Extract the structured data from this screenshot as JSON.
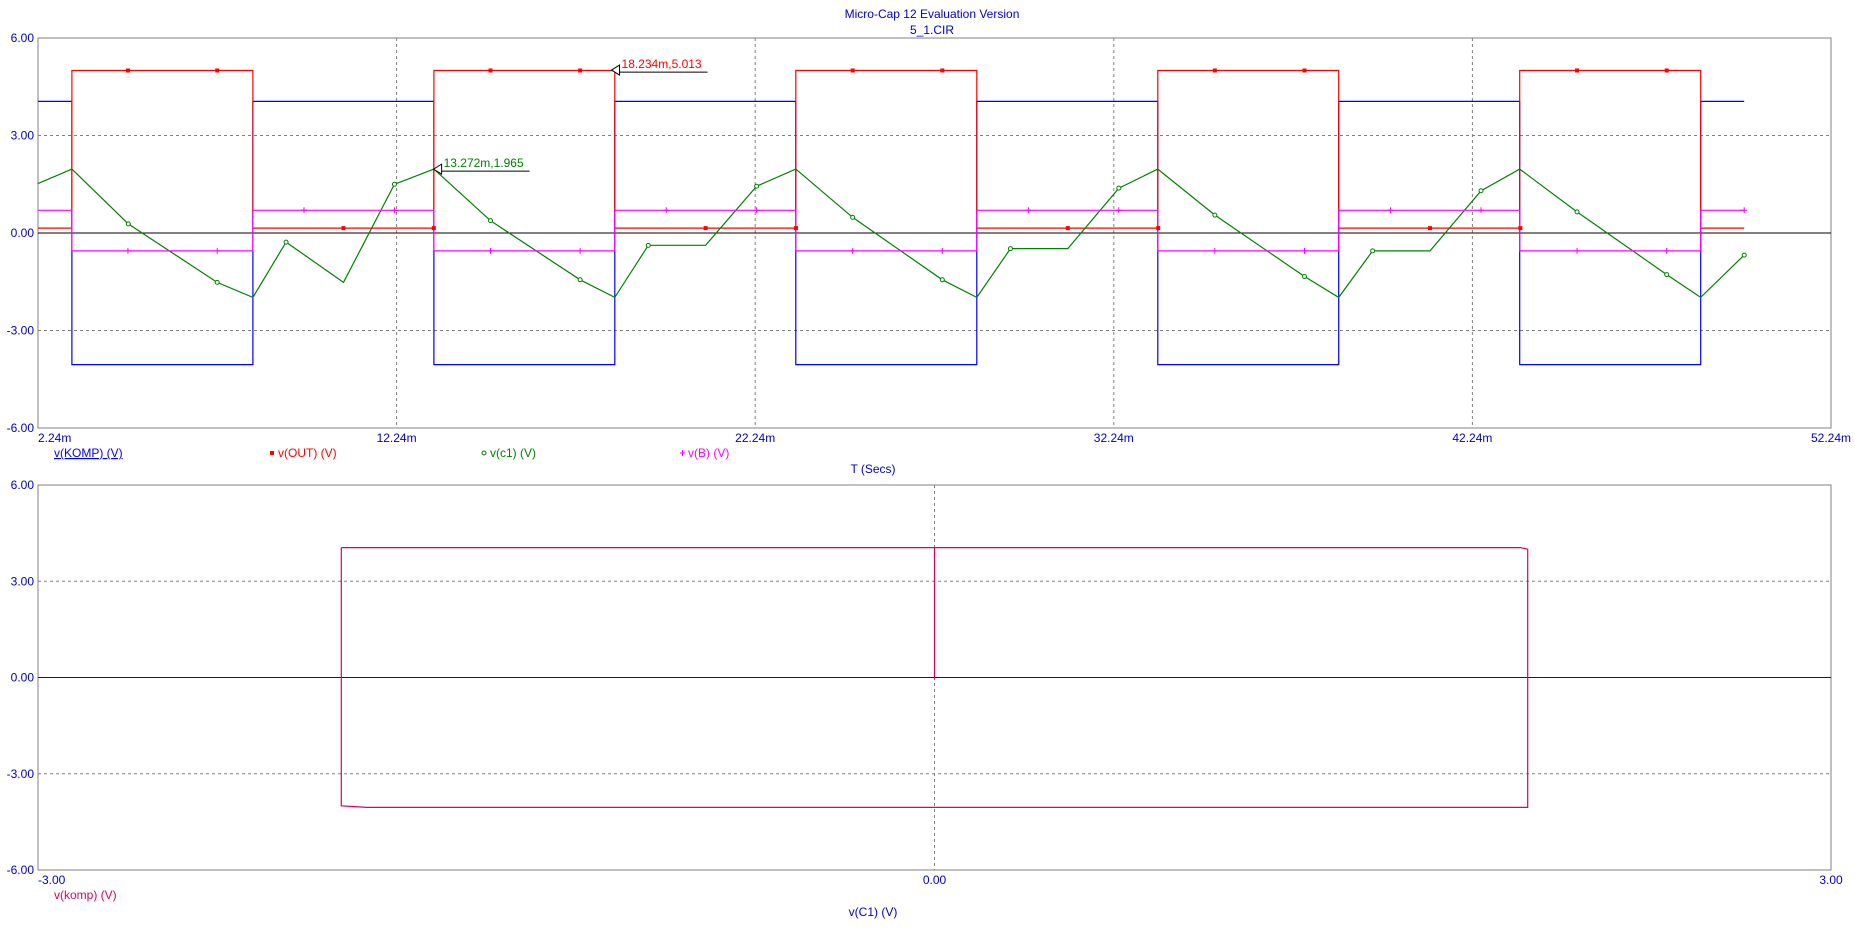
{
  "header": {
    "title": "Micro-Cap 12 Evaluation Version",
    "subtitle": "5_1.CIR"
  },
  "colors": {
    "komp": "#0000ff",
    "out": "#ff0000",
    "c1": "#008000",
    "b": "#ff00ff",
    "xy_trace": "#dc0064",
    "axis_text": "#0000c8",
    "grid": "#808080"
  },
  "chart_data": [
    {
      "type": "line",
      "id": "transient",
      "xlabel": "T (Secs)",
      "xlim": [
        0.00224,
        0.05224
      ],
      "ylim": [
        -6,
        6
      ],
      "x_ticks": [
        0.00224,
        0.01224,
        0.02224,
        0.03224,
        0.04224,
        0.05224
      ],
      "x_tick_labels": [
        "2.24m",
        "12.24m",
        "22.24m",
        "32.24m",
        "42.24m",
        "52.24m"
      ],
      "y_ticks": [
        -6,
        -3,
        0,
        3,
        6
      ],
      "y_tick_labels": [
        "-6.00",
        "-3.00",
        "0.00",
        "3.00",
        "6.00"
      ],
      "grid": true,
      "series": [
        {
          "name": "v(KOMP) (V)",
          "color_key": "komp",
          "marker": "none",
          "x": [
            0.00224,
            0.003186,
            0.003186,
            0.008233,
            0.008233,
            0.01328,
            0.01328,
            0.018326,
            0.018326,
            0.023373,
            0.023373,
            0.02842,
            0.02842,
            0.033466,
            0.033466,
            0.038513,
            0.038513,
            0.04356,
            0.04356,
            0.048607,
            0.048607,
            0.04982
          ],
          "y": [
            4.05,
            4.05,
            -4.05,
            -4.05,
            4.05,
            4.05,
            -4.05,
            -4.05,
            4.05,
            4.05,
            -4.05,
            -4.05,
            4.05,
            4.05,
            -4.05,
            -4.05,
            4.05,
            4.05,
            -4.05,
            -4.05,
            4.05,
            4.05
          ]
        },
        {
          "name": "v(OUT) (V)",
          "color_key": "out",
          "marker": "square",
          "x": [
            0.00224,
            0.003186,
            0.003186,
            0.008233,
            0.008233,
            0.01328,
            0.01328,
            0.018326,
            0.018326,
            0.023373,
            0.023373,
            0.02842,
            0.02842,
            0.033466,
            0.033466,
            0.038513,
            0.038513,
            0.04356,
            0.04356,
            0.048607,
            0.048607,
            0.04982
          ],
          "y": [
            0.15,
            0.15,
            5.0,
            5.0,
            0.15,
            0.15,
            5.0,
            5.0,
            0.15,
            0.15,
            5.0,
            5.0,
            0.15,
            0.15,
            5.0,
            5.0,
            0.15,
            0.15,
            5.0,
            5.0,
            0.15,
            0.15
          ],
          "marker_x": [
            0.004748,
            0.007238,
            0.010758,
            0.013278,
            0.014858,
            0.017358,
            0.020858,
            0.023378,
            0.024958,
            0.027458,
            0.030958,
            0.033478,
            0.035058,
            0.037558,
            0.041058,
            0.043578,
            0.045158,
            0.047658
          ],
          "marker_y": [
            5.0,
            5.0,
            0.15,
            0.15,
            5.0,
            5.0,
            0.15,
            0.15,
            5.0,
            5.0,
            0.15,
            0.15,
            5.0,
            5.0,
            0.15,
            0.15,
            5.0,
            5.0
          ]
        },
        {
          "name": "v(c1) (V)",
          "color_key": "c1",
          "marker": "circle",
          "x": [
            0.00224,
            0.003186,
            0.004758,
            0.007238,
            0.008233,
            0.009158,
            0.010758,
            0.01218,
            0.01328,
            0.014858,
            0.017358,
            0.018326,
            0.019258,
            0.020858,
            0.02228,
            0.023373,
            0.024958,
            0.027458,
            0.02842,
            0.029358,
            0.030958,
            0.03238,
            0.033466,
            0.035058,
            0.037558,
            0.038513,
            0.039458,
            0.041058,
            0.04248,
            0.04356,
            0.045158,
            0.047658,
            0.048607,
            0.04982
          ],
          "y": [
            1.52,
            1.965,
            0.28,
            -1.52,
            -1.98,
            -0.28,
            -1.52,
            1.5,
            1.965,
            0.38,
            -1.44,
            -1.98,
            -0.38,
            -0.38,
            1.44,
            1.965,
            0.48,
            -1.44,
            -1.98,
            -0.48,
            -0.48,
            1.38,
            1.965,
            0.55,
            -1.34,
            -1.98,
            -0.55,
            -0.55,
            1.3,
            1.965,
            0.65,
            -1.28,
            -1.98,
            -0.68
          ],
          "marker_x": [
            0.004758,
            0.007238,
            0.009158,
            0.01218,
            0.014858,
            0.017358,
            0.019258,
            0.02228,
            0.024958,
            0.027458,
            0.029358,
            0.03238,
            0.035058,
            0.037558,
            0.039458,
            0.04248,
            0.045158,
            0.047658,
            0.04982
          ],
          "marker_y": [
            0.28,
            -1.52,
            -0.28,
            1.5,
            0.38,
            -1.44,
            -0.38,
            1.44,
            0.48,
            -1.44,
            -0.48,
            1.38,
            0.55,
            -1.34,
            -0.55,
            1.3,
            0.65,
            -1.28,
            -0.68
          ]
        },
        {
          "name": "v(B) (V)",
          "color_key": "b",
          "marker": "plus",
          "x": [
            0.00224,
            0.003186,
            0.003186,
            0.008233,
            0.008233,
            0.01328,
            0.01328,
            0.018326,
            0.018326,
            0.023373,
            0.023373,
            0.02842,
            0.02842,
            0.033466,
            0.033466,
            0.038513,
            0.038513,
            0.04356,
            0.04356,
            0.048607,
            0.048607,
            0.04982
          ],
          "y": [
            0.7,
            0.7,
            -0.55,
            -0.55,
            0.7,
            0.7,
            -0.55,
            -0.55,
            0.7,
            0.7,
            -0.55,
            -0.55,
            0.7,
            0.7,
            -0.55,
            -0.55,
            0.7,
            0.7,
            -0.55,
            -0.55,
            0.7,
            0.7
          ],
          "marker_x": [
            0.004748,
            0.007238,
            0.009658,
            0.01218,
            0.014858,
            0.017358,
            0.019758,
            0.02228,
            0.024958,
            0.027458,
            0.029858,
            0.03238,
            0.035058,
            0.037558,
            0.039958,
            0.04248,
            0.045158,
            0.047658,
            0.04982
          ],
          "marker_y": [
            -0.55,
            -0.55,
            0.7,
            0.7,
            -0.55,
            -0.55,
            0.7,
            0.7,
            -0.55,
            -0.55,
            0.7,
            0.7,
            -0.55,
            -0.55,
            0.7,
            0.7,
            -0.55,
            -0.55,
            0.7
          ]
        }
      ],
      "annotations": [
        {
          "label": "18.234m,5.013",
          "x": 0.018234,
          "y": 5.013,
          "color_key": "out"
        },
        {
          "label": "13.272m,1.965",
          "x": 0.013272,
          "y": 1.965,
          "color_key": "c1"
        }
      ]
    },
    {
      "type": "line",
      "id": "xy",
      "xlabel": "v(C1) (V)",
      "xlim": [
        -3,
        3
      ],
      "ylim": [
        -6,
        6
      ],
      "x_ticks": [
        -3,
        0,
        3
      ],
      "x_tick_labels": [
        "-3.00",
        "0.00",
        "3.00"
      ],
      "y_ticks": [
        -6,
        -3,
        0,
        3,
        6
      ],
      "y_tick_labels": [
        "-6.00",
        "-3.00",
        "0.00",
        "3.00",
        "6.00"
      ],
      "grid": true,
      "series": [
        {
          "name": "v(komp) (V)",
          "color_key": "xy_trace",
          "marker": "none",
          "x": [
            -1.985,
            -1.985,
            0.0,
            0.0,
            0.0,
            1.985,
            1.985,
            -1.985
          ],
          "y": [
            4.05,
            -4.0,
            -4.05,
            4.05,
            -0.05,
            4.05,
            -4.05,
            -4.05
          ],
          "path_x": [
            -1.985,
            0.0,
            0.0,
            0.0,
            1.96,
            1.985,
            1.985,
            -1.9,
            -1.985,
            -1.985
          ],
          "path_y": [
            4.05,
            4.05,
            -0.05,
            4.05,
            4.05,
            4.0,
            -4.05,
            -4.05,
            -4.0,
            4.05
          ]
        }
      ],
      "zero_line_color_key": "komp"
    }
  ]
}
